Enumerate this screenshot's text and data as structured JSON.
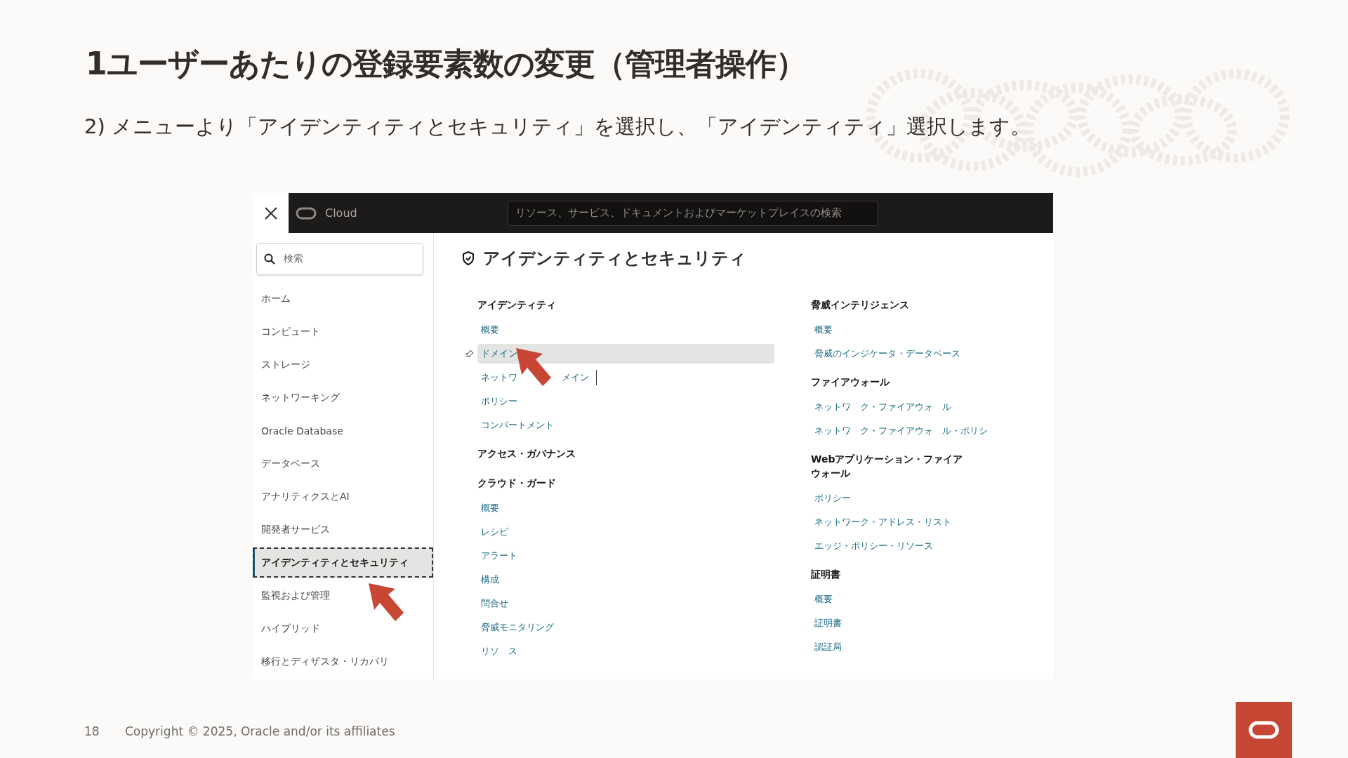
{
  "slide": {
    "title": "1ユーザーあたりの登録要素数の変更（管理者操作）",
    "subtitle": "2) メニューより「アイデンティティとセキュリティ」を選択し、「アイデンティティ」選択します。",
    "page_number": "18",
    "copyright": "Copyright © 2025, Oracle and/or its affiliates"
  },
  "console": {
    "top_bar": {
      "brand": "Cloud",
      "search_placeholder": "リソース、サービス、ドキュメントおよびマーケットプレイスの検索"
    },
    "sidebar": {
      "search_placeholder": "検索",
      "items": [
        {
          "label": "ホーム",
          "selected": false
        },
        {
          "label": "コンピュート",
          "selected": false
        },
        {
          "label": "ストレージ",
          "selected": false
        },
        {
          "label": "ネットワーキング",
          "selected": false
        },
        {
          "label": "Oracle Database",
          "selected": false
        },
        {
          "label": "データベース",
          "selected": false
        },
        {
          "label": "アナリティクスとAI",
          "selected": false
        },
        {
          "label": "開発者サービス",
          "selected": false
        },
        {
          "label": "アイデンティティとセキュリティ",
          "selected": true
        },
        {
          "label": "監視および管理",
          "selected": false
        },
        {
          "label": "ハイブリッド",
          "selected": false
        },
        {
          "label": "移行とディザスタ・リカバリ",
          "selected": false
        }
      ]
    },
    "panel": {
      "title": "アイデンティティとセキュリティ",
      "columns": [
        [
          {
            "heading": "アイデンティティ",
            "links": [
              {
                "label": "概要",
                "selected": false
              },
              {
                "label": "ドメイン",
                "selected": true
              },
              {
                "parts": [
                  "ネットワ",
                  "メイン"
                ],
                "selected": false
              },
              {
                "label": "ポリシー",
                "selected": false
              },
              {
                "label": "コンパートメント",
                "selected": false
              }
            ]
          },
          {
            "heading": "アクセス・ガバナンス"
          },
          {
            "heading": "クラウド・ガード",
            "links": [
              {
                "label": "概要",
                "selected": false
              },
              {
                "label": "レシピ",
                "selected": false
              },
              {
                "label": "アラート",
                "selected": false
              },
              {
                "label": "構成",
                "selected": false
              },
              {
                "label": "問合せ",
                "selected": false
              },
              {
                "label": "脅威モニタリング",
                "selected": false
              },
              {
                "label": "リソ　ス",
                "selected": false
              }
            ]
          }
        ],
        [
          {
            "heading": "脅威インテリジェンス",
            "links": [
              {
                "label": "概要",
                "selected": false
              },
              {
                "label": "脅威のインジケータ・データベース",
                "selected": false
              }
            ]
          },
          {
            "heading": "ファイアウォール",
            "links": [
              {
                "label": "ネットワ　ク・ファイアウォ　ル",
                "selected": false
              },
              {
                "label": "ネットワ　ク・ファイアウォ　ル・ポリシ",
                "selected": false
              }
            ]
          },
          {
            "heading": "Webアプリケーション・ファイアウォール",
            "links": [
              {
                "label": "ポリシー",
                "selected": false
              },
              {
                "label": "ネットワーク・アドレス・リスト",
                "selected": false
              },
              {
                "label": "エッジ・ポリシー・リソース",
                "selected": false
              }
            ]
          },
          {
            "heading": "証明書",
            "links": [
              {
                "label": "概要",
                "selected": false
              },
              {
                "label": "証明書",
                "selected": false
              },
              {
                "label": "認証局",
                "selected": false
              }
            ]
          }
        ]
      ]
    }
  }
}
